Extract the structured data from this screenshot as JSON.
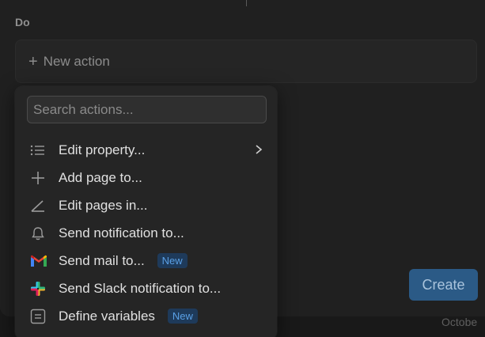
{
  "section": {
    "label": "Do"
  },
  "new_action": {
    "label": "New action"
  },
  "create_button": {
    "label": "Create"
  },
  "background_text": {
    "october": "Octobe"
  },
  "menu": {
    "search_placeholder": "Search actions...",
    "items": [
      {
        "label": "Edit property...",
        "icon": "list-icon",
        "has_submenu": true
      },
      {
        "label": "Add page to...",
        "icon": "plus-icon"
      },
      {
        "label": "Edit pages in...",
        "icon": "angle-pencil-icon"
      },
      {
        "label": "Send notification to...",
        "icon": "bell-icon"
      },
      {
        "label": "Send mail to...",
        "icon": "gmail-icon",
        "badge": "New"
      },
      {
        "label": "Send Slack notification to...",
        "icon": "slack-icon"
      },
      {
        "label": "Define variables",
        "icon": "variables-icon",
        "badge": "New"
      }
    ]
  },
  "colors": {
    "background": "#191919",
    "modal": "#202020",
    "menu": "#252525",
    "accent": "#2b5a86",
    "badge_bg": "#1e3a5a",
    "badge_text": "#5aa0e6"
  }
}
